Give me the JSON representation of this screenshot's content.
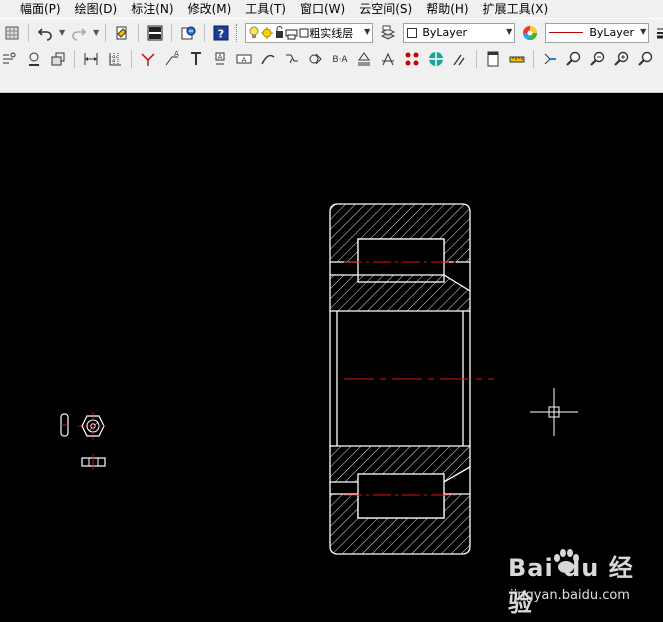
{
  "menu": {
    "items": [
      {
        "label": "幅面(P)"
      },
      {
        "label": "绘图(D)"
      },
      {
        "label": "标注(N)"
      },
      {
        "label": "修改(M)"
      },
      {
        "label": "工具(T)"
      },
      {
        "label": "窗口(W)"
      },
      {
        "label": "云空间(S)"
      },
      {
        "label": "帮助(H)"
      },
      {
        "label": "扩展工具(X)"
      }
    ]
  },
  "properties_bar": {
    "layer_value": "粗实线层",
    "color_value": "ByLayer",
    "linetype_value": "ByLayer"
  },
  "colors": {
    "canvas_background": "#000000",
    "drawing_outline": "#ffffff",
    "center_line": "#e01010",
    "crosshair": "#ffffff",
    "toolbar_background": "#f0f0f0"
  },
  "icons": {
    "toolbar1": [
      "grid-icon",
      "undo-icon",
      "redo-icon",
      "properties-icon",
      "dwg-convert-icon",
      "print-icon",
      "help-icon",
      "lightbulb-icon",
      "sun-icon",
      "lock-icon",
      "printer-layer-icon",
      "layer-manager-icon",
      "color-wheel-icon",
      "lineweight-icon"
    ],
    "toolbar2": [
      "align-icon",
      "dimension-icon",
      "block-icon",
      "linear-dimension-icon",
      "ordinate-icon",
      "angle-dimension-icon",
      "leader-icon",
      "text-icon",
      "frame-text-icon",
      "arc-dimension-icon",
      "chain-icon",
      "weld-icon",
      "ba-icon",
      "stamp-icon",
      "datum-icon",
      "target-icon",
      "hatch-circle-icon",
      "angle-icon",
      "sheet-icon",
      "ruler-icon",
      "rotate-icon",
      "zoom-icon",
      "zoom-window-icon",
      "zoom-pan-icon",
      "zoom-prev-icon"
    ]
  },
  "watermark": {
    "logo_text": "Bai du 经验",
    "url_text": "jingyan.baidu.com"
  }
}
